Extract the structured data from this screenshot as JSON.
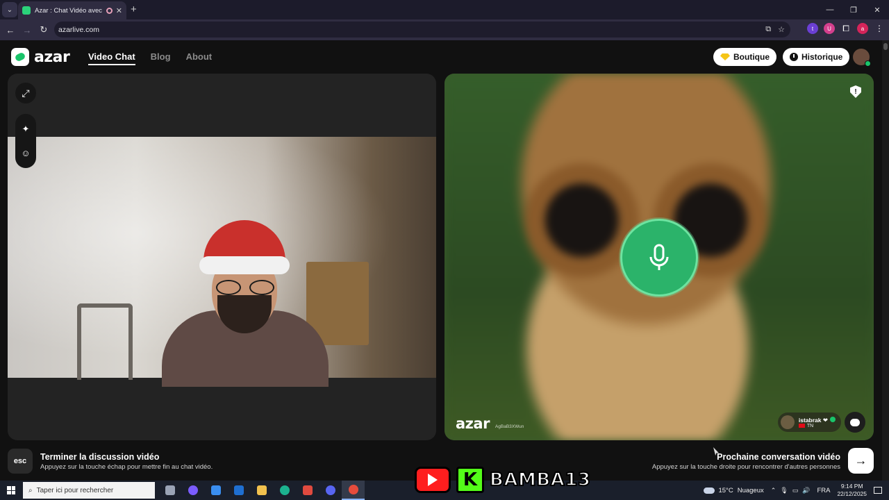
{
  "browser": {
    "tab_title": "Azar : Chat Vidéo avec de n",
    "url": "azarlive.com",
    "menu_glyph": "⌄",
    "new_tab": "+",
    "close": "✕",
    "window": {
      "minimize": "—",
      "restore": "❐",
      "close": "✕"
    },
    "nav": {
      "back": "←",
      "forward": "→",
      "reload": "↻"
    },
    "extensions": [
      {
        "name": "t",
        "color": "#6b3fd4"
      },
      {
        "name": "U",
        "color": "#d43f8d"
      },
      {
        "name": "a",
        "color": "#d4245a"
      }
    ]
  },
  "site": {
    "logo_text": "azar",
    "nav": [
      "Video Chat",
      "Blog",
      "About"
    ],
    "boutique_label": "Boutique",
    "historique_label": "Historique"
  },
  "left_panel": {
    "expand_icon": "⤢",
    "effects_icon": "✦",
    "sticker_icon": "☺"
  },
  "right_panel": {
    "watermark": "azar",
    "session_id": "AgBaB3XWun",
    "peer": {
      "name": "istabrak ❤",
      "country": "TN"
    },
    "report_icon": "!"
  },
  "footer": {
    "esc_key": "esc",
    "end_title": "Terminer la discussion vidéo",
    "end_sub": "Appuyez sur la touche échap pour mettre fin au chat vidéo.",
    "next_title": "Prochaine conversation vidéo",
    "next_sub": "Appuyez sur la touche droite pour rencontrer d'autres personnes",
    "next_arrow": "→"
  },
  "taskbar": {
    "search_placeholder": "Taper ici pour rechercher",
    "search_icon": "⌕",
    "apps": [
      {
        "name": "task-view",
        "color": "#9aa3b5"
      },
      {
        "name": "copilot",
        "color": "#7b5cff"
      },
      {
        "name": "store",
        "color": "#3a8ef0"
      },
      {
        "name": "mail",
        "color": "#1f6fd1"
      },
      {
        "name": "explorer",
        "color": "#f2c14e"
      },
      {
        "name": "edge",
        "color": "#1cb28f"
      },
      {
        "name": "app-red",
        "color": "#e04a3f"
      },
      {
        "name": "discord",
        "color": "#5865f2"
      },
      {
        "name": "chrome",
        "color": "#e74c3c"
      }
    ],
    "weather": "15°C",
    "weather_desc": "Nuageux",
    "lang": "FRA",
    "time": "9:14 PM",
    "date": "22/12/2025"
  },
  "overlay": {
    "brand": "BAMBA13",
    "kick_letter": "K"
  }
}
